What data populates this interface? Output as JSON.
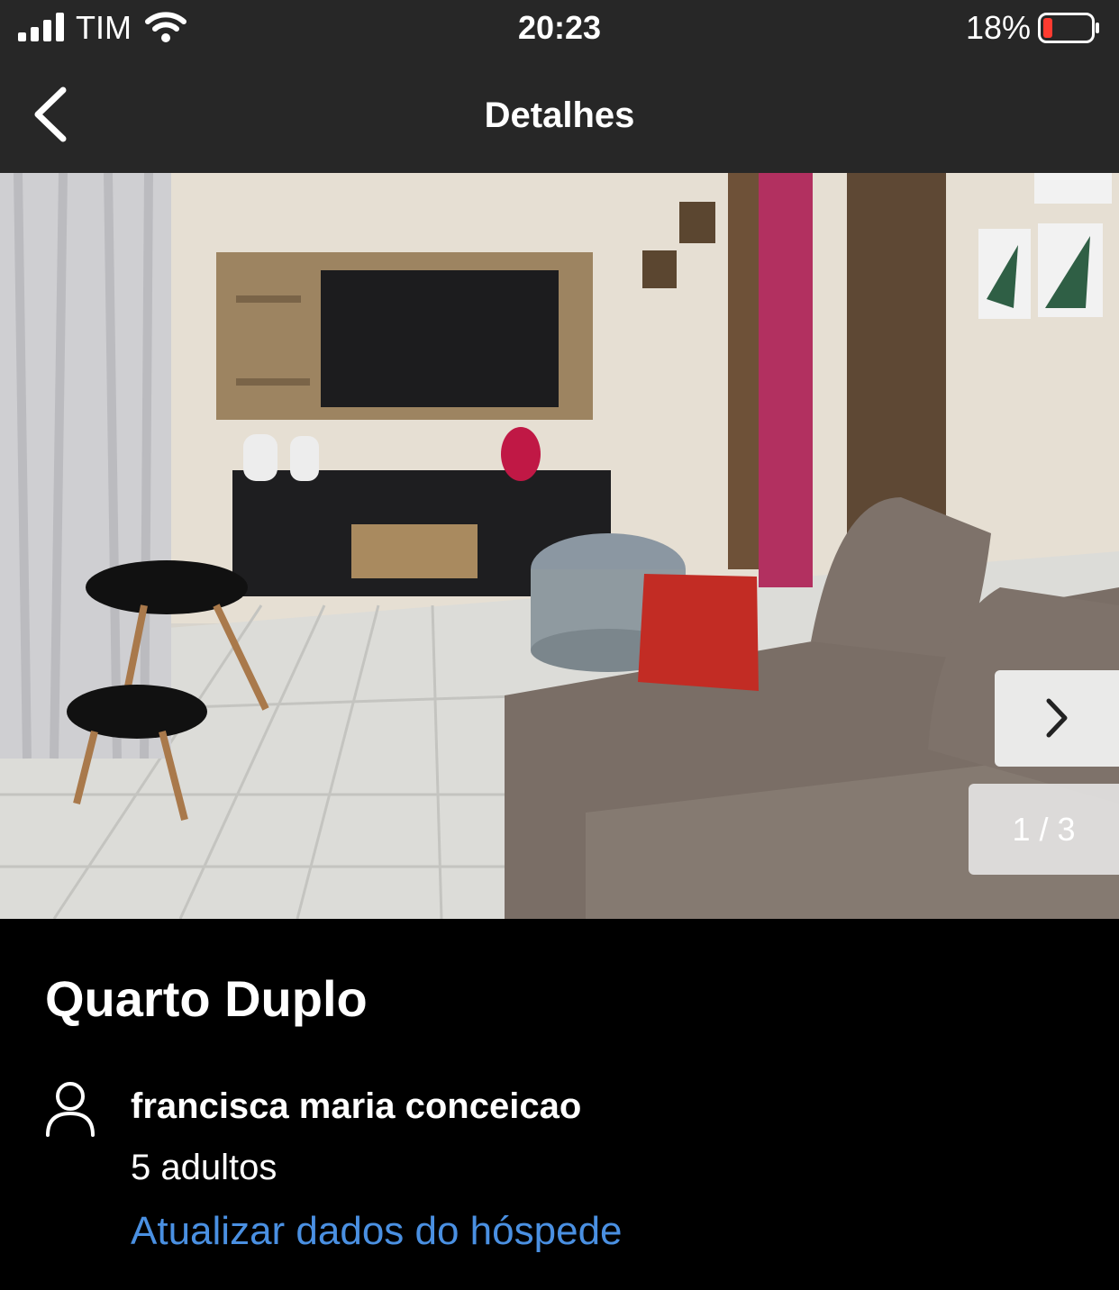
{
  "status_bar": {
    "carrier": "TIM",
    "time": "20:23",
    "battery_percent": "18%",
    "icons": [
      "signal-icon",
      "wifi-icon",
      "battery-icon"
    ],
    "battery_color": "#ff3b30"
  },
  "nav": {
    "title": "Detalhes",
    "back_icon": "chevron-left-icon"
  },
  "gallery": {
    "counter": "1 / 3",
    "next_icon": "chevron-right-icon"
  },
  "room": {
    "title": "Quarto Duplo"
  },
  "guest": {
    "icon": "person-icon",
    "name": "francisca maria conceicao",
    "count": "5 adultos",
    "update_link": "Atualizar dados do hóspede"
  },
  "colors": {
    "bar_background": "#272727",
    "page_background": "#000000",
    "link": "#4a90e2"
  }
}
